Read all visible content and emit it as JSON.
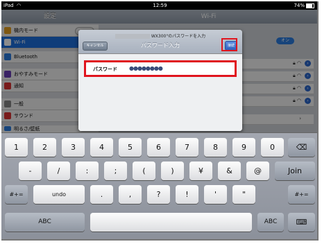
{
  "status": {
    "carrier": "iPad",
    "time": "12:59",
    "battery": "74%"
  },
  "left_panel": {
    "title": "設定",
    "items": [
      {
        "label": "機内モード",
        "icon_color": "#e8a020"
      },
      {
        "label": "Wi-Fi",
        "icon_color": "#2a7de1"
      },
      {
        "label": "Bluetooth",
        "icon_color": "#2a7de1"
      },
      {
        "label": "おやすみモード",
        "icon_color": "#6b3fb8"
      },
      {
        "label": "通知",
        "icon_color": "#d33"
      },
      {
        "label": "一般",
        "icon_color": "#888"
      },
      {
        "label": "サウンド",
        "icon_color": "#d33"
      },
      {
        "label": "明るさ/壁紙",
        "icon_color": "#2a7de1"
      }
    ]
  },
  "right_panel": {
    "title": "Wi-Fi",
    "toggle_label": "オン"
  },
  "modal": {
    "prompt_suffix": "WX300\"のパスワードを入力",
    "title": "パスワード入力",
    "cancel_label": "キャンセル",
    "join_label": "接続",
    "field_label": "パスワード",
    "field_value": "●●●●●●●●"
  },
  "keyboard": {
    "row1": [
      "1",
      "2",
      "3",
      "4",
      "5",
      "6",
      "7",
      "8",
      "9",
      "0"
    ],
    "backspace": "⌫",
    "row2": [
      "-",
      "/",
      ":",
      ";",
      "(",
      ")",
      "¥",
      "&",
      "@"
    ],
    "join": "Join",
    "row3_left": "#+=",
    "undo": "undo",
    "row3": [
      ".",
      ",",
      "?",
      "!",
      "'",
      "\""
    ],
    "row3_right": "#+=",
    "abc_left": "ABC",
    "abc_right": "ABC",
    "dismiss": "⌨"
  },
  "colors": {
    "highlight": "#e0141e",
    "accent": "#2a7de1"
  }
}
